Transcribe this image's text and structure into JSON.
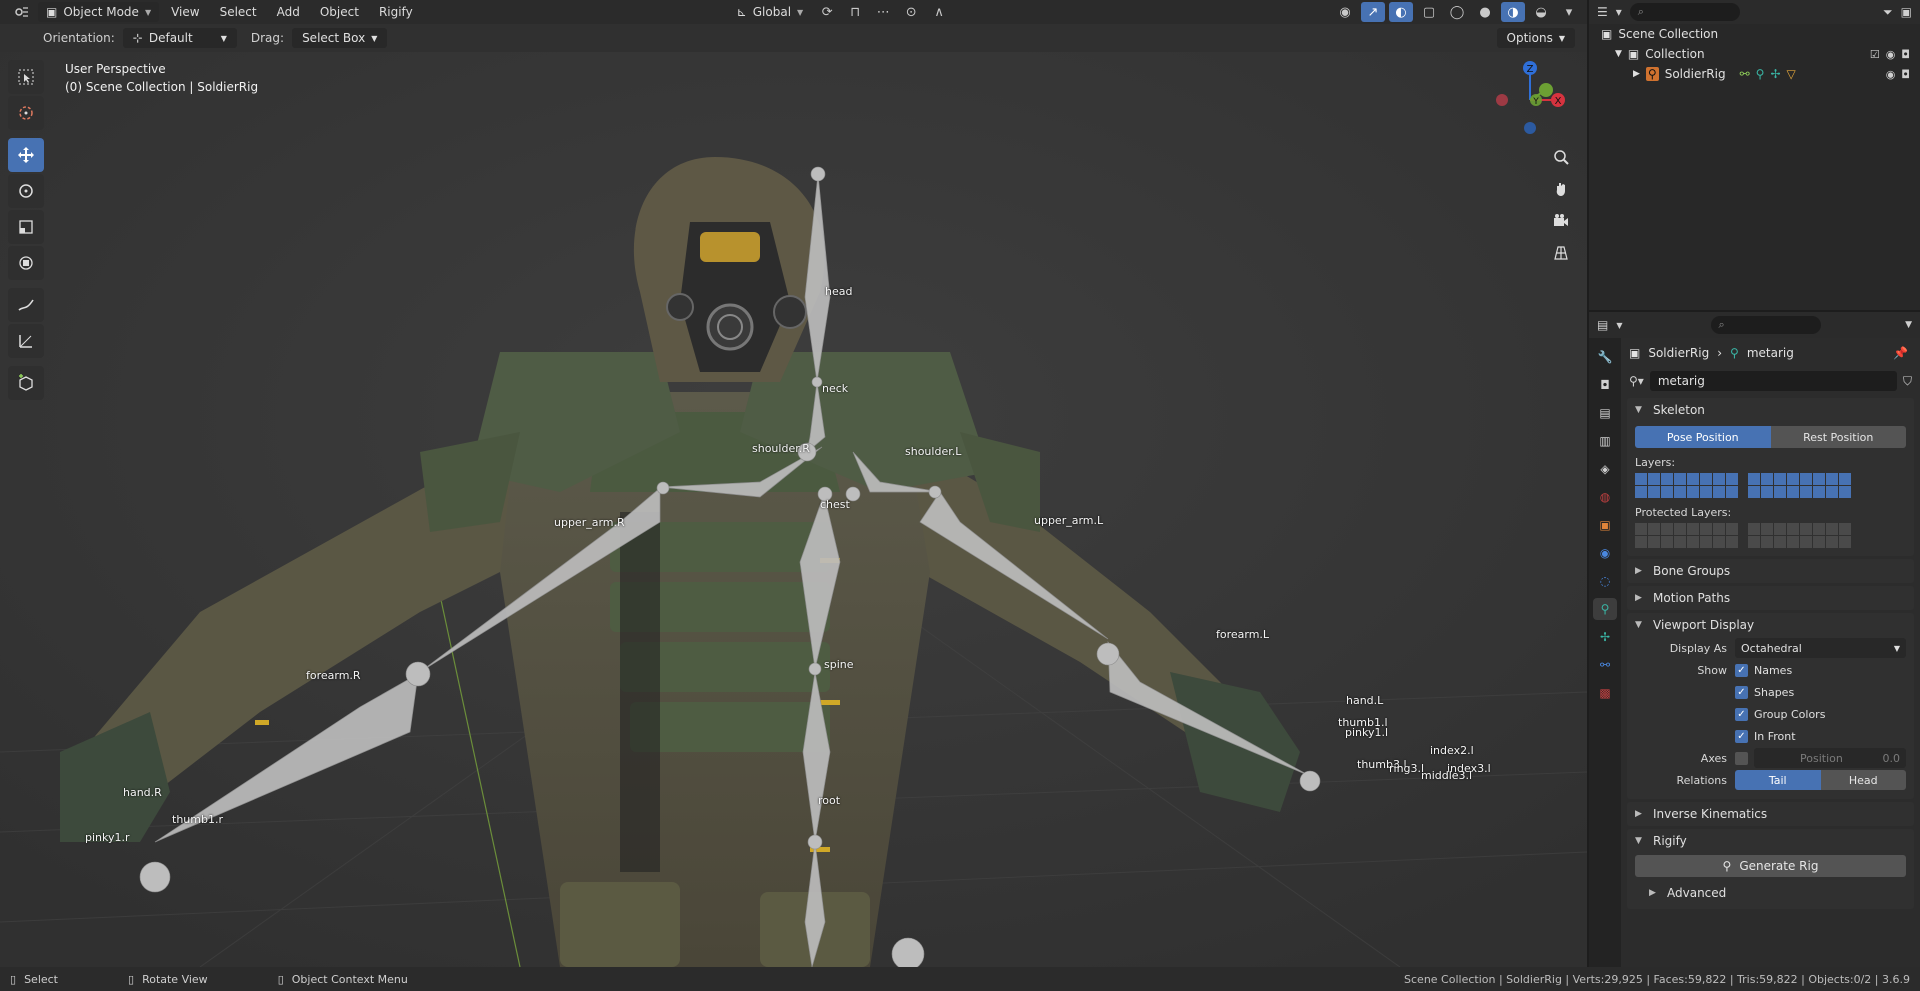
{
  "header": {
    "mode": "Object Mode",
    "menus": [
      "View",
      "Select",
      "Add",
      "Object",
      "Rigify"
    ],
    "transform_orientation": "Global"
  },
  "tool_header": {
    "orientation_label": "Orientation:",
    "orientation_value": "Default",
    "drag_label": "Drag:",
    "drag_value": "Select Box",
    "options": "Options"
  },
  "viewport": {
    "perspective": "User Perspective",
    "collection_info": "(0) Scene Collection | SoldierRig",
    "gizmo": {
      "x": "X",
      "y": "Y",
      "z": "Z"
    },
    "bones": [
      "head",
      "neck",
      "shoulder.R",
      "shoulder.L",
      "chest",
      "upper_arm.R",
      "upper_arm.L",
      "forearm.R",
      "forearm.L",
      "spine",
      "hand.R",
      "hand.L",
      "root",
      "thumb1.r",
      "pinky1.r",
      "thumb1.l",
      "pinky1.l",
      "index3.l",
      "middle3.l",
      "thumb3.l",
      "ring3.l",
      "index2.l"
    ]
  },
  "outliner": {
    "scene": "Scene Collection",
    "collection": "Collection",
    "object": "SoldierRig"
  },
  "properties": {
    "breadcrumb_object": "SoldierRig",
    "breadcrumb_data": "metarig",
    "data_name": "metarig",
    "skeleton": {
      "title": "Skeleton",
      "pose_position": "Pose Position",
      "rest_position": "Rest Position",
      "layers": "Layers:",
      "protected_layers": "Protected Layers:"
    },
    "collapsed_panels": {
      "bone_groups": "Bone Groups",
      "motion_paths": "Motion Paths",
      "inverse_kinematics": "Inverse Kinematics"
    },
    "viewport_display": {
      "title": "Viewport Display",
      "display_as_label": "Display As",
      "display_as_value": "Octahedral",
      "show_label": "Show",
      "names": "Names",
      "shapes": "Shapes",
      "group_colors": "Group Colors",
      "in_front": "In Front",
      "axes_label": "Axes",
      "position_label": "Position",
      "position_value": "0.0",
      "relations_label": "Relations",
      "tail": "Tail",
      "head": "Head"
    },
    "rigify": {
      "title": "Rigify",
      "generate": "Generate Rig",
      "advanced": "Advanced"
    }
  },
  "statusbar": {
    "select": "Select",
    "rotate": "Rotate View",
    "context": "Object Context Menu",
    "stats": "Scene Collection | SoldierRig | Verts:29,925 | Faces:59,822 | Tris:59,822 | Objects:0/2 | 3.6.9"
  },
  "colors": {
    "accent": "#4772b3",
    "viewport_bg": "#393939",
    "bone": "#bcbcbc"
  }
}
